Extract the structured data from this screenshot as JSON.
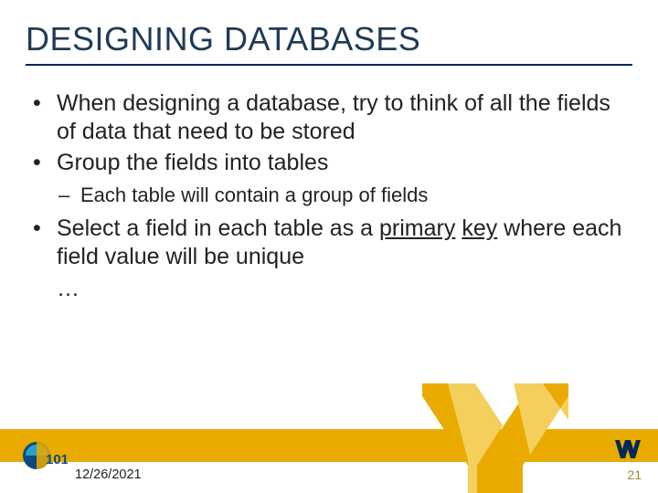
{
  "title": "DESIGNING DATABASES",
  "bullets": {
    "b1": "When designing a database, try to think of all the fields of data that need to be stored",
    "b2": "Group the fields into tables",
    "sub1": "Each table will contain a group of fields",
    "b3_pre": "Select a field in each table as a ",
    "b3_ul1": "primary",
    "b3_mid": " ",
    "b3_ul2": "key",
    "b3_post": " where each field value will be unique",
    "ellipsis": "…"
  },
  "footer": {
    "date": "12/26/2021",
    "page": "21"
  },
  "colors": {
    "navy": "#002855",
    "gold": "#eaab00"
  }
}
